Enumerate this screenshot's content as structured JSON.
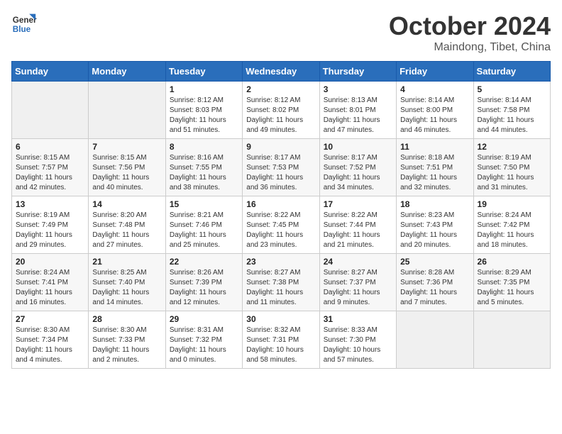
{
  "logo": {
    "line1": "General",
    "line2": "Blue"
  },
  "title": "October 2024",
  "subtitle": "Maindong, Tibet, China",
  "days_header": [
    "Sunday",
    "Monday",
    "Tuesday",
    "Wednesday",
    "Thursday",
    "Friday",
    "Saturday"
  ],
  "weeks": [
    [
      {
        "day": "",
        "info": ""
      },
      {
        "day": "",
        "info": ""
      },
      {
        "day": "1",
        "info": "Sunrise: 8:12 AM\nSunset: 8:03 PM\nDaylight: 11 hours and 51 minutes."
      },
      {
        "day": "2",
        "info": "Sunrise: 8:12 AM\nSunset: 8:02 PM\nDaylight: 11 hours and 49 minutes."
      },
      {
        "day": "3",
        "info": "Sunrise: 8:13 AM\nSunset: 8:01 PM\nDaylight: 11 hours and 47 minutes."
      },
      {
        "day": "4",
        "info": "Sunrise: 8:14 AM\nSunset: 8:00 PM\nDaylight: 11 hours and 46 minutes."
      },
      {
        "day": "5",
        "info": "Sunrise: 8:14 AM\nSunset: 7:58 PM\nDaylight: 11 hours and 44 minutes."
      }
    ],
    [
      {
        "day": "6",
        "info": "Sunrise: 8:15 AM\nSunset: 7:57 PM\nDaylight: 11 hours and 42 minutes."
      },
      {
        "day": "7",
        "info": "Sunrise: 8:15 AM\nSunset: 7:56 PM\nDaylight: 11 hours and 40 minutes."
      },
      {
        "day": "8",
        "info": "Sunrise: 8:16 AM\nSunset: 7:55 PM\nDaylight: 11 hours and 38 minutes."
      },
      {
        "day": "9",
        "info": "Sunrise: 8:17 AM\nSunset: 7:53 PM\nDaylight: 11 hours and 36 minutes."
      },
      {
        "day": "10",
        "info": "Sunrise: 8:17 AM\nSunset: 7:52 PM\nDaylight: 11 hours and 34 minutes."
      },
      {
        "day": "11",
        "info": "Sunrise: 8:18 AM\nSunset: 7:51 PM\nDaylight: 11 hours and 32 minutes."
      },
      {
        "day": "12",
        "info": "Sunrise: 8:19 AM\nSunset: 7:50 PM\nDaylight: 11 hours and 31 minutes."
      }
    ],
    [
      {
        "day": "13",
        "info": "Sunrise: 8:19 AM\nSunset: 7:49 PM\nDaylight: 11 hours and 29 minutes."
      },
      {
        "day": "14",
        "info": "Sunrise: 8:20 AM\nSunset: 7:48 PM\nDaylight: 11 hours and 27 minutes."
      },
      {
        "day": "15",
        "info": "Sunrise: 8:21 AM\nSunset: 7:46 PM\nDaylight: 11 hours and 25 minutes."
      },
      {
        "day": "16",
        "info": "Sunrise: 8:22 AM\nSunset: 7:45 PM\nDaylight: 11 hours and 23 minutes."
      },
      {
        "day": "17",
        "info": "Sunrise: 8:22 AM\nSunset: 7:44 PM\nDaylight: 11 hours and 21 minutes."
      },
      {
        "day": "18",
        "info": "Sunrise: 8:23 AM\nSunset: 7:43 PM\nDaylight: 11 hours and 20 minutes."
      },
      {
        "day": "19",
        "info": "Sunrise: 8:24 AM\nSunset: 7:42 PM\nDaylight: 11 hours and 18 minutes."
      }
    ],
    [
      {
        "day": "20",
        "info": "Sunrise: 8:24 AM\nSunset: 7:41 PM\nDaylight: 11 hours and 16 minutes."
      },
      {
        "day": "21",
        "info": "Sunrise: 8:25 AM\nSunset: 7:40 PM\nDaylight: 11 hours and 14 minutes."
      },
      {
        "day": "22",
        "info": "Sunrise: 8:26 AM\nSunset: 7:39 PM\nDaylight: 11 hours and 12 minutes."
      },
      {
        "day": "23",
        "info": "Sunrise: 8:27 AM\nSunset: 7:38 PM\nDaylight: 11 hours and 11 minutes."
      },
      {
        "day": "24",
        "info": "Sunrise: 8:27 AM\nSunset: 7:37 PM\nDaylight: 11 hours and 9 minutes."
      },
      {
        "day": "25",
        "info": "Sunrise: 8:28 AM\nSunset: 7:36 PM\nDaylight: 11 hours and 7 minutes."
      },
      {
        "day": "26",
        "info": "Sunrise: 8:29 AM\nSunset: 7:35 PM\nDaylight: 11 hours and 5 minutes."
      }
    ],
    [
      {
        "day": "27",
        "info": "Sunrise: 8:30 AM\nSunset: 7:34 PM\nDaylight: 11 hours and 4 minutes."
      },
      {
        "day": "28",
        "info": "Sunrise: 8:30 AM\nSunset: 7:33 PM\nDaylight: 11 hours and 2 minutes."
      },
      {
        "day": "29",
        "info": "Sunrise: 8:31 AM\nSunset: 7:32 PM\nDaylight: 11 hours and 0 minutes."
      },
      {
        "day": "30",
        "info": "Sunrise: 8:32 AM\nSunset: 7:31 PM\nDaylight: 10 hours and 58 minutes."
      },
      {
        "day": "31",
        "info": "Sunrise: 8:33 AM\nSunset: 7:30 PM\nDaylight: 10 hours and 57 minutes."
      },
      {
        "day": "",
        "info": ""
      },
      {
        "day": "",
        "info": ""
      }
    ]
  ]
}
